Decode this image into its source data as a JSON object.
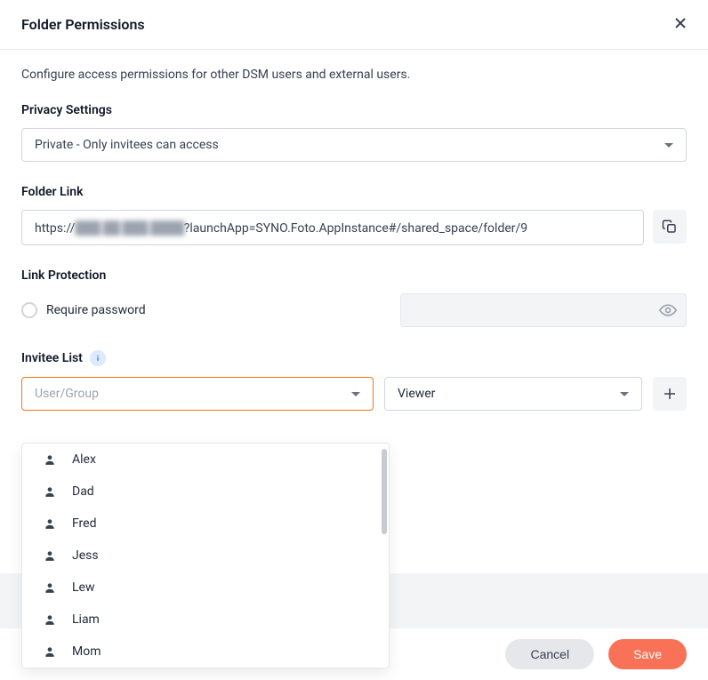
{
  "header": {
    "title": "Folder Permissions"
  },
  "description": "Configure access permissions for other DSM users and external users.",
  "privacy": {
    "label": "Privacy Settings",
    "value": "Private - Only invitees can access"
  },
  "folder_link": {
    "label": "Folder Link",
    "prefix": "https://",
    "obscured": "███.██ ███.████",
    "suffix": "?launchApp=SYNO.Foto.AppInstance#/shared_space/folder/9"
  },
  "link_protection": {
    "label": "Link Protection",
    "require_password_label": "Require password"
  },
  "invitee": {
    "label": "Invitee List",
    "placeholder": "User/Group",
    "role": "Viewer",
    "options": [
      "Alex",
      "Dad",
      "Fred",
      "Jess",
      "Lew",
      "Liam",
      "Mom"
    ]
  },
  "footer": {
    "cancel": "Cancel",
    "save": "Save"
  }
}
